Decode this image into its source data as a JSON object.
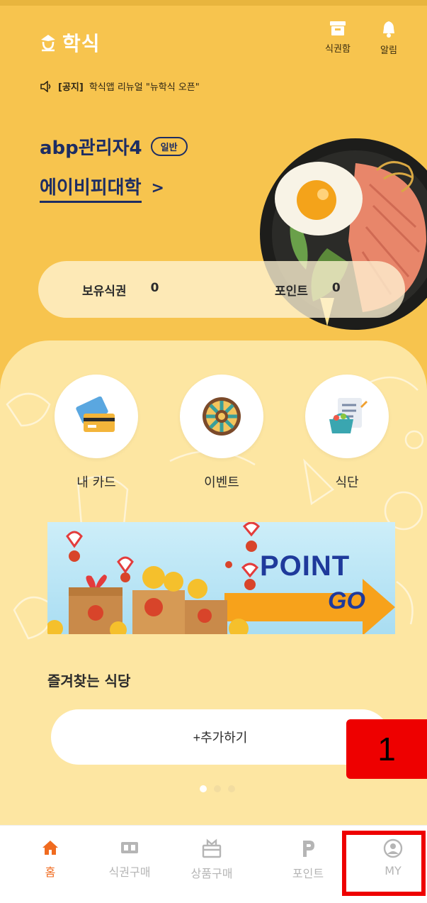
{
  "header": {
    "app_title": "학식",
    "wallet_label": "식권함",
    "notifications_label": "알림"
  },
  "notice": {
    "tag": "[공지]",
    "text": "학식앱 리뉴얼 \"뉴학식 오픈\""
  },
  "user": {
    "name": "abp관리자4",
    "badge": "일반",
    "university": "에이비피대학",
    "chevron": ">"
  },
  "stats": {
    "tickets_label": "보유식권",
    "tickets_value": "0",
    "points_label": "포인트",
    "points_value": "0"
  },
  "quick_menu": [
    {
      "label": "내 카드",
      "icon": "credit-card-icon"
    },
    {
      "label": "이벤트",
      "icon": "roulette-wheel-icon"
    },
    {
      "label": "식단",
      "icon": "meal-plan-checklist-icon"
    }
  ],
  "banner": {
    "word1": "POINT",
    "word2": "GO"
  },
  "favorites": {
    "title": "즐겨찾는 식당",
    "add_label": "+추가하기",
    "page_count": 3,
    "active_page": 1
  },
  "annotation": {
    "label": "1"
  },
  "bottom_nav": [
    {
      "label": "홈",
      "icon": "home-icon",
      "active": true
    },
    {
      "label": "식권구매",
      "icon": "ticket-icon",
      "active": false
    },
    {
      "label": "상품구매",
      "icon": "gift-box-icon",
      "active": false
    },
    {
      "label": "포인트",
      "icon": "point-p-icon",
      "active": false
    },
    {
      "label": "MY",
      "icon": "user-profile-icon",
      "active": false
    }
  ],
  "colors": {
    "primary_yellow": "#f7c44e",
    "panel_yellow": "#fde6a2",
    "navy_text": "#1d2d63",
    "active_orange": "#f06b1f",
    "annotation_red": "#ee0000"
  }
}
